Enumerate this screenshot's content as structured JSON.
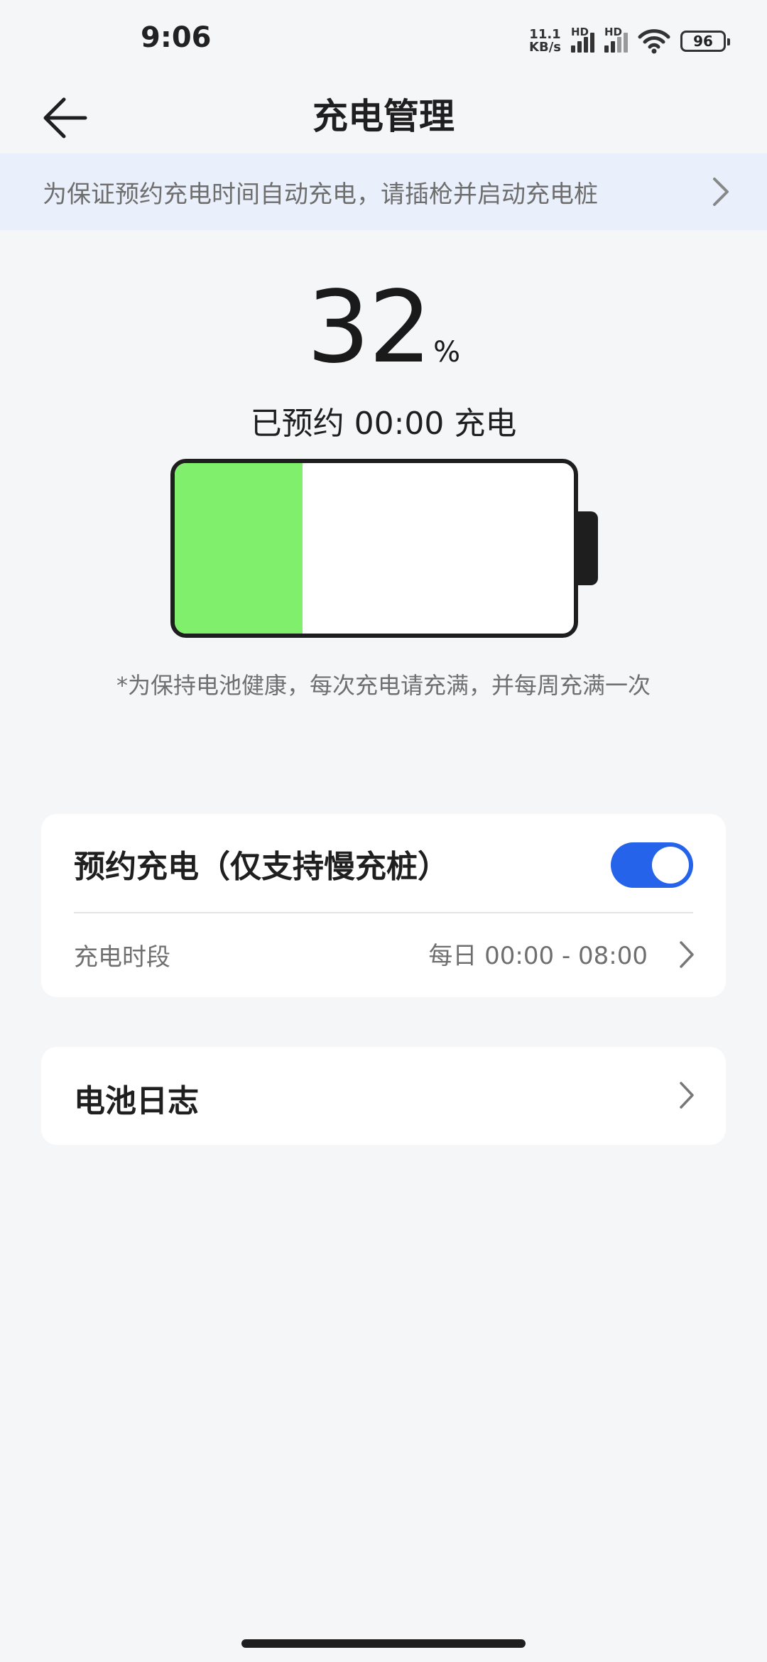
{
  "status_bar": {
    "time": "9:06",
    "net_speed_top": "11.1",
    "net_speed_bottom": "KB/s",
    "sim1_label": "HD",
    "sim2_label": "HD",
    "battery_level": "96",
    "icons": [
      "signal-icon",
      "signal-icon",
      "wifi-icon",
      "battery-icon"
    ]
  },
  "header": {
    "title": "充电管理",
    "back_icon": "arrow-left-icon"
  },
  "notice": {
    "text": "为保证预约充电时间自动充电，请插枪并启动充电桩",
    "icon": "chevron-right-icon"
  },
  "battery": {
    "percent": "32",
    "percent_sign": "%",
    "level_fraction": 0.32,
    "schedule_text": "已预约 00:00 充电",
    "health_tip": "*为保持电池健康，每次充电请充满，并每周充满一次",
    "fill_color": "#80ef6b"
  },
  "schedule_card": {
    "title": "预约充电（仅支持慢充桩）",
    "toggle_on": true,
    "toggle_color": "#2563eb",
    "period_label": "充电时段",
    "period_value": "每日 00:00 - 08:00"
  },
  "log_card": {
    "title": "电池日志"
  }
}
